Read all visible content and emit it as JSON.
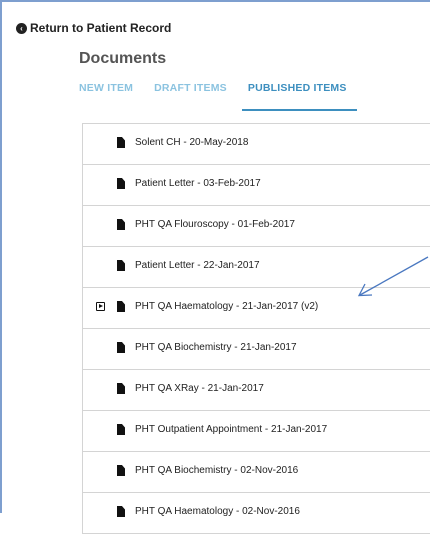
{
  "header": {
    "return_label": "Return to Patient Record",
    "title": "Documents"
  },
  "tabs": [
    {
      "label": "NEW ITEM",
      "active": false
    },
    {
      "label": "DRAFT ITEMS",
      "active": false
    },
    {
      "label": "PUBLISHED ITEMS",
      "active": true
    }
  ],
  "documents": [
    {
      "label": "Solent CH - 20-May-2018"
    },
    {
      "label": "Patient Letter - 03-Feb-2017"
    },
    {
      "label": "PHT QA Flouroscopy - 01-Feb-2017"
    },
    {
      "label": "Patient Letter - 22-Jan-2017"
    },
    {
      "label": "PHT QA Haematology - 21-Jan-2017 (v2)",
      "has_versions": true
    },
    {
      "label": "PHT QA Biochemistry - 21-Jan-2017"
    },
    {
      "label": "PHT QA XRay - 21-Jan-2017"
    },
    {
      "label": "PHT Outpatient Appointment - 21-Jan-2017"
    },
    {
      "label": "PHT QA Biochemistry - 02-Nov-2016"
    },
    {
      "label": "PHT QA Haematology - 02-Nov-2016"
    }
  ],
  "colors": {
    "tab_inactive": "#8bc3e0",
    "tab_active": "#3d8fbf",
    "annotation_arrow": "#4a78c0"
  }
}
